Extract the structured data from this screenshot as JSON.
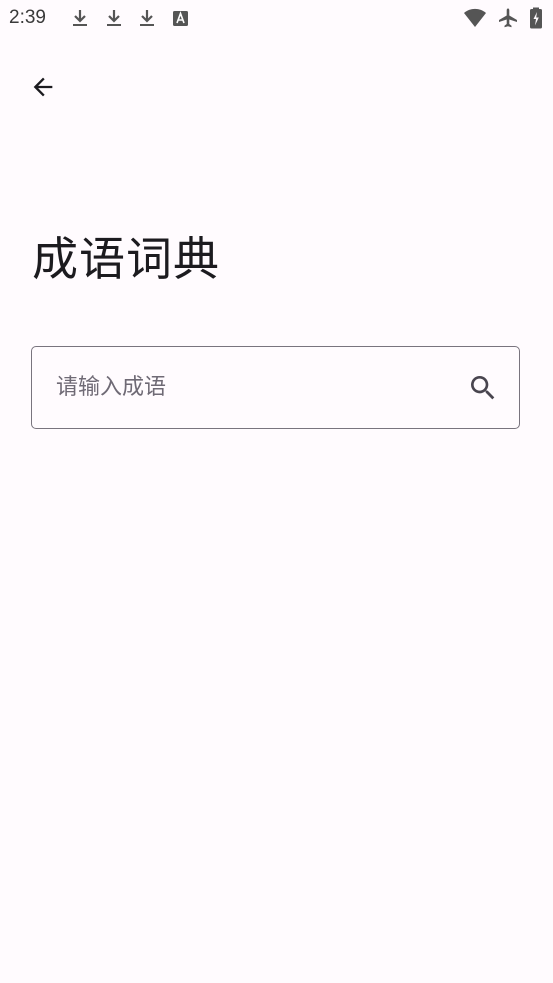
{
  "status_bar": {
    "time": "2:39",
    "left_icons": [
      "download-icon",
      "download-icon",
      "download-icon",
      "text-a-icon"
    ],
    "right_icons": [
      "wifi-icon",
      "airplane-mode-icon",
      "battery-charging-icon"
    ]
  },
  "header": {
    "back_icon": "arrow-back-icon"
  },
  "page": {
    "title": "成语词典"
  },
  "search": {
    "placeholder": "请输入成语",
    "value": "",
    "icon": "search-icon"
  },
  "colors": {
    "background": "#fffbfe",
    "text": "#1c1b1f",
    "outline": "#79747e",
    "placeholder": "#6f6a75"
  }
}
